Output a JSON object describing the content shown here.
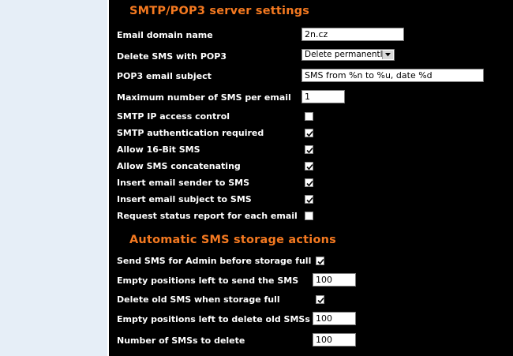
{
  "smtp_section": {
    "title": "SMTP/POP3 server settings",
    "rows": [
      {
        "label": "Email domain name",
        "type": "text",
        "value": "2n.cz"
      },
      {
        "label": "Delete SMS with POP3",
        "type": "select",
        "value": "Delete permanently"
      },
      {
        "label": "POP3 email subject",
        "type": "text",
        "value": "SMS from %n to %u, date %d"
      },
      {
        "label": "Maximum number of SMS per email",
        "type": "text",
        "value": "1"
      },
      {
        "label": "SMTP IP access control",
        "type": "checkbox",
        "checked": false
      },
      {
        "label": "SMTP authentication required",
        "type": "checkbox",
        "checked": true
      },
      {
        "label": "Allow 16-Bit SMS",
        "type": "checkbox",
        "checked": true
      },
      {
        "label": "Allow SMS concatenating",
        "type": "checkbox",
        "checked": true
      },
      {
        "label": "Insert email sender to SMS",
        "type": "checkbox",
        "checked": true
      },
      {
        "label": "Insert email subject to SMS",
        "type": "checkbox",
        "checked": true
      },
      {
        "label": "Request status report for each email",
        "type": "checkbox",
        "checked": false
      }
    ]
  },
  "storage_section": {
    "title": "Automatic SMS storage actions",
    "rows": [
      {
        "label": "Send SMS for Admin before storage full",
        "type": "checkbox",
        "checked": true
      },
      {
        "label": "Empty positions left to send the SMS",
        "type": "text",
        "value": "100"
      },
      {
        "label": "Delete old SMS when storage full",
        "type": "checkbox",
        "checked": true
      },
      {
        "label": "Empty positions left to delete old SMSs",
        "type": "text",
        "value": "100"
      },
      {
        "label": "Number of SMSs to delete",
        "type": "text",
        "value": "100"
      }
    ]
  },
  "colors": {
    "accent": "#f47920",
    "background": "#000000",
    "sidebar": "#e6eef7"
  },
  "icons": {
    "checkbox_checked": "checkmark-icon",
    "select_arrow": "chevron-down-icon"
  }
}
